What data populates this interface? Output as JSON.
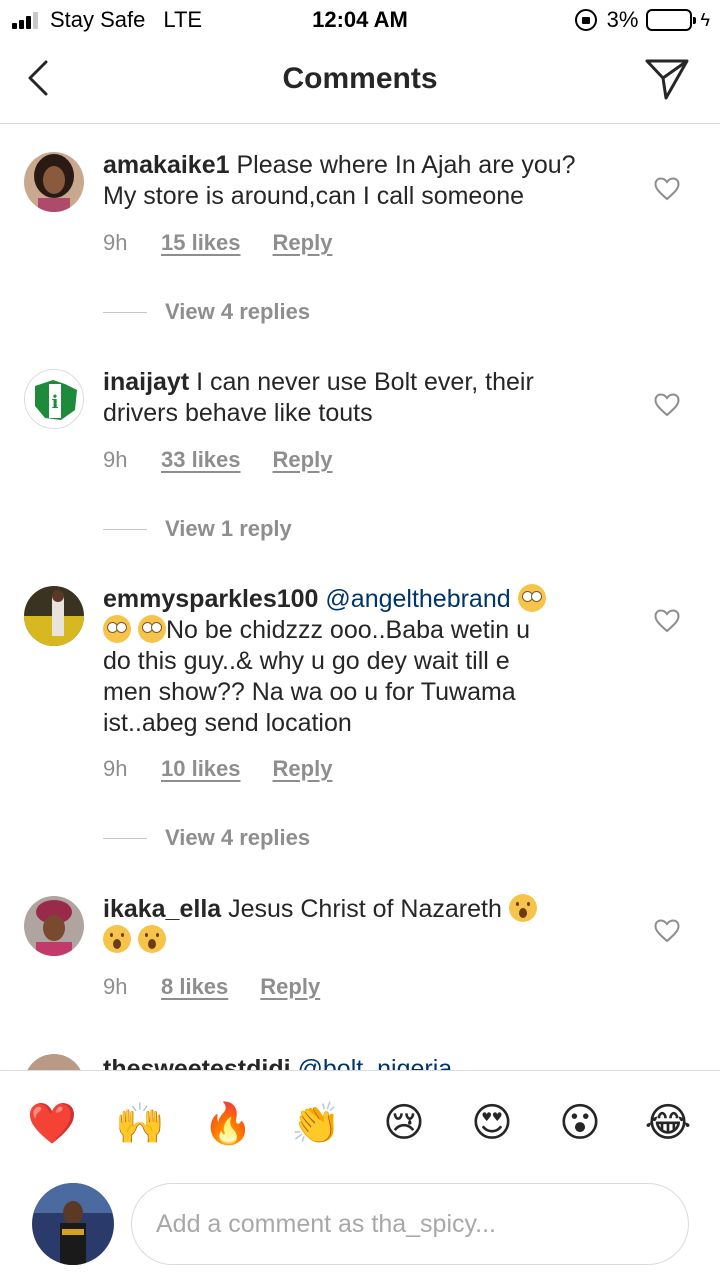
{
  "status_bar": {
    "carrier": "Stay Safe",
    "network": "LTE",
    "time": "12:04 AM",
    "battery": "3%",
    "battery_level": 0.03
  },
  "header": {
    "title": "Comments"
  },
  "comments": [
    {
      "username": "amakaike1",
      "text_lines": [
        "Please where In Ajah are you?",
        "My store is around,can I call someone"
      ],
      "time": "9h",
      "likes": "15 likes",
      "reply": "Reply",
      "view_replies": "View 4 replies"
    },
    {
      "username": "inaijayt",
      "text_lines": [
        "I can never use Bolt ever, their",
        "drivers behave like touts"
      ],
      "time": "9h",
      "likes": "33 likes",
      "reply": "Reply",
      "view_replies": "View 1 reply"
    },
    {
      "username": "emmysparkles100",
      "mention": "@angelthebrand",
      "text_lines": [
        "No be chidzzz ooo..Baba wetin u",
        "do this guy..& why u go dey wait till e",
        "men show?? Na wa oo u for Tuwama",
        "ist..abeg send location"
      ],
      "time": "9h",
      "likes": "10 likes",
      "reply": "Reply",
      "view_replies": "View 4 replies"
    },
    {
      "username": "ikaka_ella",
      "text_lines": [
        "Jesus Christ of Nazareth"
      ],
      "time": "9h",
      "likes": "8 likes",
      "reply": "Reply"
    },
    {
      "username": "thesweetestdidi",
      "mention": "@bolt_nigeria"
    }
  ],
  "reactions": [
    "❤️",
    "🙌",
    "🔥",
    "👏",
    "😢",
    "😍",
    "😮",
    "😂"
  ],
  "composer": {
    "placeholder": "Add a comment as tha_spicy..."
  },
  "colors": {
    "text": "#262626",
    "secondary": "#8e8e8e",
    "mention": "#003569",
    "divider": "#dbdbdb"
  }
}
